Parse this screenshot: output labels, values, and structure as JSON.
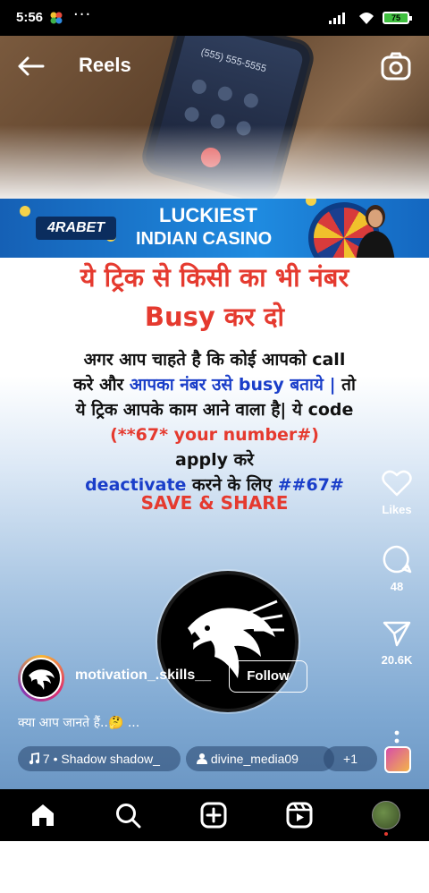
{
  "status_bar": {
    "time": "5:56",
    "more": "···",
    "battery": "75"
  },
  "header": {
    "title": "Reels"
  },
  "ad_banner": {
    "logo": "4RABET",
    "line1": "LUCKIEST",
    "line2": "INDIAN CASINO"
  },
  "post": {
    "phone_number": "(555) 555-5555",
    "headline_line1": "ये ट्रिक से किसी का भी नंबर",
    "headline_line2": "Busy कर दो",
    "body": {
      "l1": "अगर आप चाहते है कि कोई आपको call",
      "l2a": "करे और ",
      "l2b": "आपका नंबर उसे busy बताये |",
      "l2c": " तो",
      "l3": "ये ट्रिक आपके काम आने वाला है| ये code",
      "l4": "(**67* your number#)",
      "l5": "apply करे",
      "l6a": "deactivate",
      "l6b": " करने के लिए ",
      "l6c": "##67#"
    },
    "save_share": "SAVE & SHARE"
  },
  "actions": {
    "likes": "Likes",
    "comments": "48",
    "shares": "20.6K"
  },
  "author": {
    "username": "motivation_.skills__",
    "follow": "Follow"
  },
  "caption": "क्या आप जानते हैं..🤔 ...",
  "chips": {
    "audio": "7 • Shadow    shadow_",
    "tagged": "divine_media09",
    "more": "+1"
  },
  "colors": {
    "headline_red": "#e53a2f",
    "accent_blue": "#1a3ec9"
  }
}
